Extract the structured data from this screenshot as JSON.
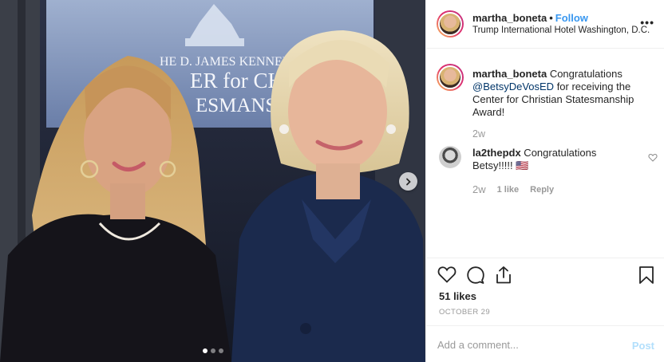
{
  "header": {
    "username": "martha_boneta",
    "separator": "•",
    "follow_label": "Follow",
    "location": "Trump International Hotel Washington, D.C.",
    "more_label": "•••"
  },
  "media": {
    "sign_lines": [
      "HE D. JAMES KENNEDY",
      "ER for CHRI",
      "ESMANS"
    ],
    "carousel_dots": 3,
    "active_dot": 1
  },
  "caption": {
    "username": "martha_boneta",
    "text_before": " Congratulations ",
    "mention": "@BetsyDeVosED",
    "text_after": " for receiving the Center for Christian Statesmanship Award!",
    "time": "2w"
  },
  "comments": [
    {
      "username": "la2thepdx",
      "text": " Congratulations Betsy!!!!! 🇺🇸",
      "time": "2w",
      "likes": "1 like",
      "reply_label": "Reply"
    }
  ],
  "stats": {
    "likes": "51 likes",
    "date": "OCTOBER 29"
  },
  "add_comment": {
    "placeholder": "Add a comment...",
    "post_label": "Post"
  },
  "colors": {
    "link": "#3897f0",
    "mention": "#003569",
    "muted": "#999999",
    "post_disabled": "#b2dffc"
  }
}
